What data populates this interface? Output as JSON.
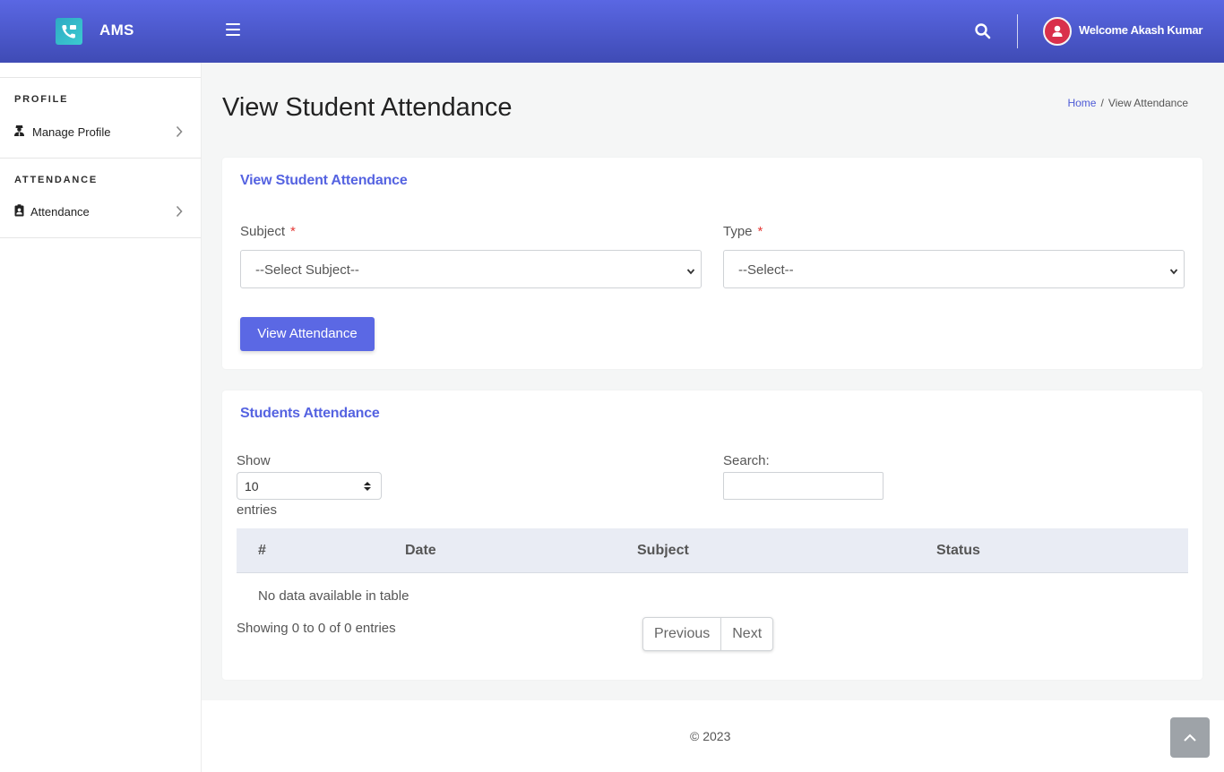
{
  "app": {
    "brand": "AMS",
    "welcome": "Welcome Akash Kumar"
  },
  "sidebar": {
    "sections": [
      {
        "heading": "PROFILE",
        "item": {
          "label": "Manage Profile",
          "icon": "user-tie-icon"
        }
      },
      {
        "heading": "ATTENDANCE",
        "item": {
          "label": "Attendance",
          "icon": "id-badge-icon"
        }
      }
    ]
  },
  "page": {
    "title": "View Student Attendance",
    "breadcrumb": {
      "home": "Home",
      "current": "View Attendance"
    }
  },
  "filter_card": {
    "title": "View Student Attendance",
    "subject": {
      "label": "Subject",
      "required_mark": "*",
      "selected": "--Select Subject--"
    },
    "type": {
      "label": "Type",
      "required_mark": "*",
      "selected": "--Select--"
    },
    "submit_label": "View Attendance"
  },
  "table_card": {
    "title": "Students Attendance",
    "length": {
      "show": "Show",
      "value": "10",
      "entries": "entries"
    },
    "search_label": "Search:",
    "search_value": "",
    "columns": [
      "#",
      "Date",
      "Subject",
      "Status"
    ],
    "empty_text": "No data available in table",
    "info": "Showing 0 to 0 of 0 entries",
    "pager": {
      "previous": "Previous",
      "next": "Next"
    }
  },
  "footer": {
    "copyright": "© 2023"
  },
  "colors": {
    "header_top": "#5a67e3",
    "header_bottom": "#3f4bb5",
    "accent": "#5b68e4",
    "avatar": "#d9304b",
    "required": "#e53935"
  }
}
